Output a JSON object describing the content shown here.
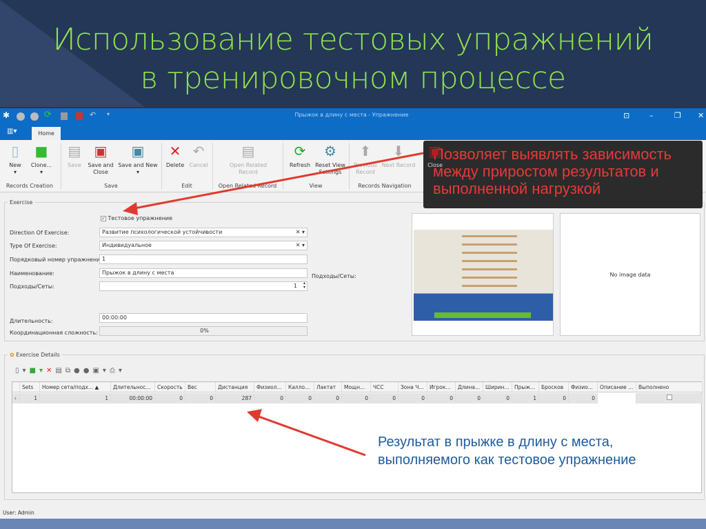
{
  "slide": {
    "title_line1": "Использование тестовых упражнений",
    "title_line2": "в тренировочном процессе"
  },
  "window": {
    "title": "Прыжок в длину с места - Упражнение",
    "tab": "Home"
  },
  "ribbon": {
    "new": "New",
    "clone": "Clone...",
    "save": "Save",
    "save_close": "Save and Close",
    "save_new": "Save and New",
    "delete": "Delete",
    "cancel": "Cancel",
    "open_related": "Open Related Record",
    "refresh": "Refresh",
    "reset_view": "Reset View Settings",
    "previous": "Previous Record",
    "next": "Next Record",
    "close": "Close",
    "groups": {
      "records_creation": "Records Creation",
      "save": "Save",
      "edit": "Edit",
      "open_related": "Open Related Record",
      "view": "View",
      "navigation": "Records Navigation"
    }
  },
  "callout_top": "Позволяет выявлять зависимость между приростом результатов и выполненной нагрузкой",
  "exercise": {
    "legend": "Exercise",
    "test_checkbox_label": "Тестовое упражнение",
    "test_checked": true,
    "direction_label": "Direction Of Exercise:",
    "direction_value": "Развитие психологической устойчивости",
    "type_label": "Type Of Exercise:",
    "type_value": "Индивидуальное",
    "order_label": "Порядковый номер упражнения:",
    "order_value": "1",
    "name_label": "Наименование:",
    "name_value": "Прыжок в длину с места",
    "sets_label": "Подходы/Сеты:",
    "sets_value": "1",
    "sets_label_right": "Подходы/Сеты:",
    "duration_label": "Длительность:",
    "duration_value": "00:00:00",
    "coord_label": "Координационная сложность:",
    "coord_value": "0%",
    "no_image": "No image data"
  },
  "details": {
    "legend": "Exercise Details",
    "columns": [
      "Sets",
      "Номер сета/подх... ▲",
      "Длительнос...",
      "Скорость",
      "Вес",
      "Дистанция",
      "Физиол...",
      "Калло...",
      "Лактат",
      "Мощн...",
      "ЧСС",
      "Зона Ч...",
      "Игрок...",
      "Длина...",
      "Ширин...",
      "Прыж...",
      "Бросков",
      "Физио...",
      "Описание ...",
      "Выполнено"
    ],
    "rows": [
      [
        "1",
        "1",
        "00:00:00",
        "0",
        "0",
        "287",
        "0",
        "0",
        "0",
        "0",
        "0",
        "0",
        "0",
        "0",
        "0",
        "1",
        "0",
        "0",
        "",
        ""
      ]
    ]
  },
  "callout_bottom": "Результат в прыжке в длину с места, выполняемого как тестовое упражнение",
  "status": "User: Admin"
}
